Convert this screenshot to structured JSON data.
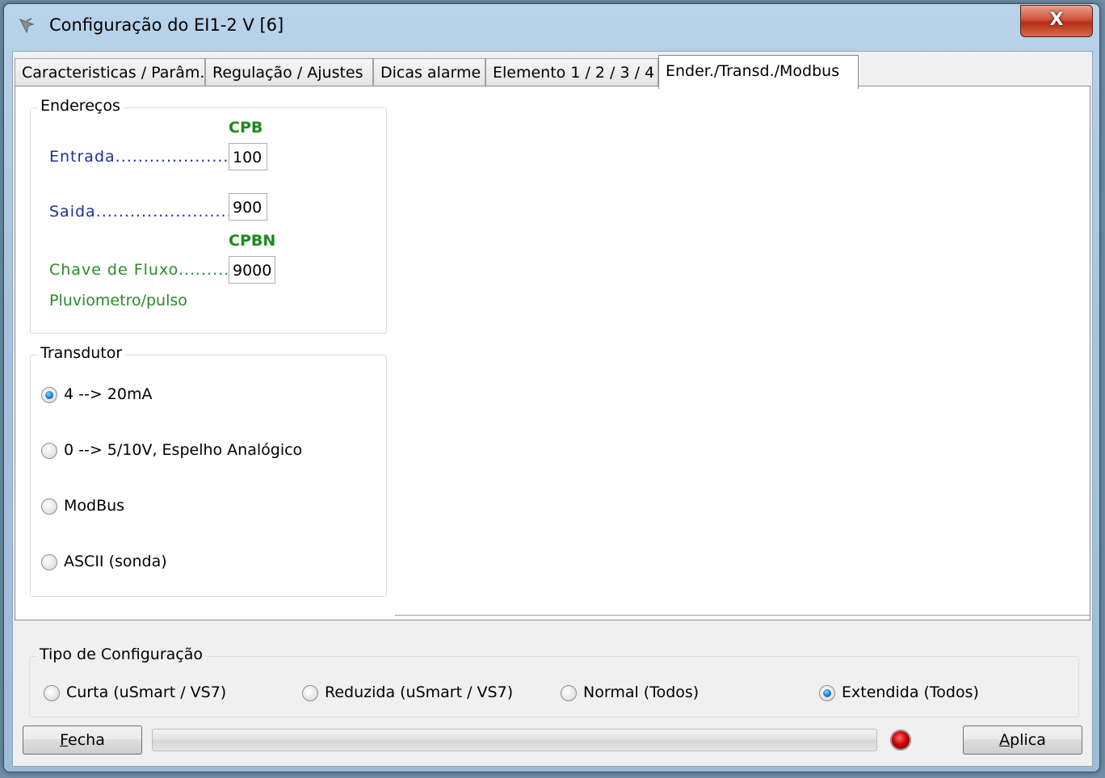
{
  "window": {
    "title": "Configuração do EI1-2 V  [6]",
    "close_label": "X"
  },
  "tabs": [
    {
      "label": "Caracteristicas / Parâm."
    },
    {
      "label": "Regulação / Ajustes"
    },
    {
      "label": "Dicas alarme"
    },
    {
      "label": "Elemento 1 / 2 / 3 / 4"
    },
    {
      "label": "Ender./Transd./Modbus",
      "active": true
    }
  ],
  "enderecos": {
    "title": "Endereços",
    "cpb_header": "CPB",
    "entrada_label": "Entrada......................",
    "entrada_value": "100",
    "saida_label": "Saida.........................",
    "saida_value": "900",
    "cpbn_header": "CPBN",
    "chave_label": "Chave de Fluxo..........",
    "chave_value": "9000",
    "pluviometro_label": "Pluviometro/pulso"
  },
  "transdutor": {
    "title": "Transdutor",
    "options": [
      {
        "label": "4 --> 20mA",
        "selected": true
      },
      {
        "label": "0 --> 5/10V, Espelho Analógico",
        "selected": false
      },
      {
        "label": "ModBus",
        "selected": false
      },
      {
        "label": "ASCII (sonda)",
        "selected": false
      }
    ]
  },
  "tipo_configuracao": {
    "title": "Tipo de Configuração",
    "options": [
      {
        "label": "Curta (uSmart / VS7)",
        "selected": false
      },
      {
        "label": "Reduzida (uSmart / VS7)",
        "selected": false
      },
      {
        "label": "Normal (Todos)",
        "selected": false
      },
      {
        "label": "Extendida (Todos)",
        "selected": true
      }
    ]
  },
  "footer": {
    "fecha_mnemonic": "F",
    "fecha_rest": "echa",
    "aplica_mnemonic": "A",
    "aplica_rest": "plica",
    "progress_fraction": 0,
    "status_led_color": "#d10000"
  }
}
